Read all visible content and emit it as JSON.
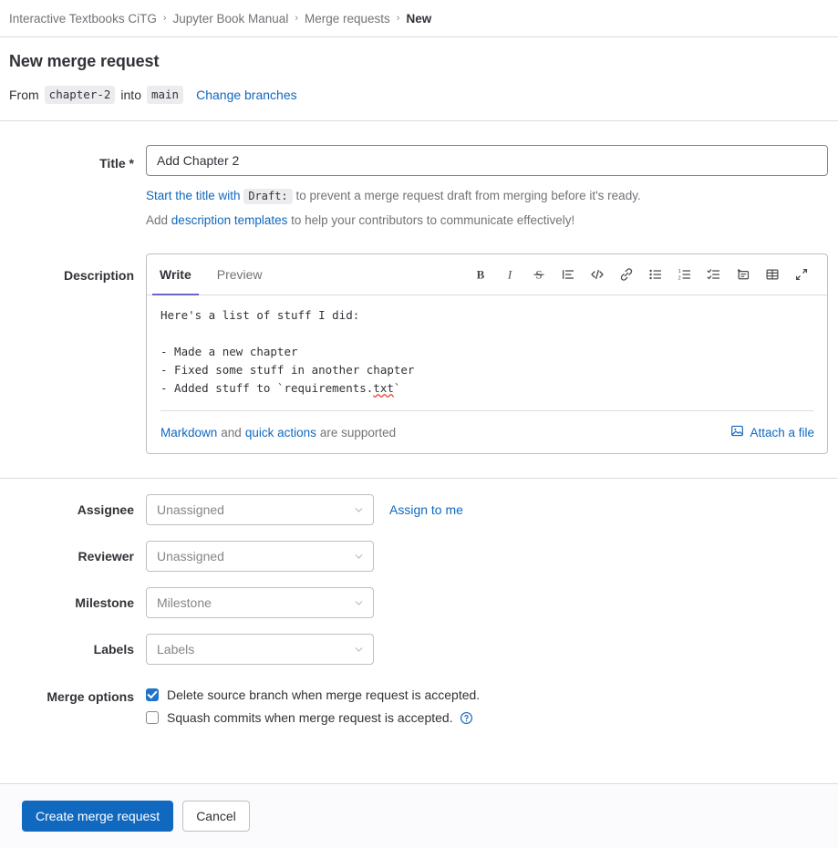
{
  "breadcrumb": {
    "separator": "›",
    "items": [
      {
        "label": "Interactive Textbooks CiTG",
        "current": false
      },
      {
        "label": "Jupyter Book Manual",
        "current": false
      },
      {
        "label": "Merge requests",
        "current": false
      },
      {
        "label": "New",
        "current": true
      }
    ]
  },
  "header": {
    "page_title": "New merge request",
    "from_word": "From",
    "source_branch": "chapter-2",
    "into_word": "into",
    "target_branch": "main",
    "change_branches_label": "Change branches"
  },
  "title_field": {
    "label": "Title *",
    "value": "Add Chapter 2",
    "placeholder": "",
    "help_1_link": "Start the title with",
    "help_1_code": "Draft:",
    "help_1_rest": "to prevent a merge request draft from merging before it's ready.",
    "help_2_prefix": "Add",
    "help_2_link": "description templates",
    "help_2_rest": "to help your contributors to communicate effectively!"
  },
  "description": {
    "label": "Description",
    "tabs": [
      {
        "label": "Write",
        "active": true
      },
      {
        "label": "Preview",
        "active": false
      }
    ],
    "toolbar": [
      {
        "name": "bold-icon",
        "title": "Bold"
      },
      {
        "name": "italic-icon",
        "title": "Italic"
      },
      {
        "name": "strikethrough-icon",
        "title": "Strikethrough"
      },
      {
        "name": "blockquote-icon",
        "title": "Insert a quote"
      },
      {
        "name": "code-icon",
        "title": "Insert code"
      },
      {
        "name": "link-icon",
        "title": "Insert a link"
      },
      {
        "name": "bullet-list-icon",
        "title": "Add a bullet list"
      },
      {
        "name": "numbered-list-icon",
        "title": "Add a numbered list"
      },
      {
        "name": "task-list-icon",
        "title": "Add a checklist"
      },
      {
        "name": "collapsible-section-icon",
        "title": "Add a collapsible section"
      },
      {
        "name": "table-icon",
        "title": "Add a table"
      },
      {
        "name": "fullscreen-icon",
        "title": "Go full screen"
      }
    ],
    "text_line_1": "Here's a list of stuff I did:",
    "text_line_2": "",
    "text_line_3": "- Made a new chapter",
    "text_line_4": "- Fixed some stuff in another chapter",
    "text_line_5_prefix": "- Added stuff to `requirements.",
    "text_line_5_misspelled": "txt",
    "text_line_5_suffix": "`",
    "footer_markdown_link": "Markdown",
    "footer_and": "and",
    "footer_quick_actions_link": "quick actions",
    "footer_supported": "are supported",
    "attach_label": "Attach a file",
    "attach_icon": "media-icon"
  },
  "fields": [
    {
      "label": "Assignee",
      "value": "Unassigned",
      "action": "Assign to me",
      "name": "assignee"
    },
    {
      "label": "Reviewer",
      "value": "Unassigned",
      "action": "",
      "name": "reviewer"
    },
    {
      "label": "Milestone",
      "value": "Milestone",
      "action": "",
      "name": "milestone"
    },
    {
      "label": "Labels",
      "value": "Labels",
      "action": "",
      "name": "labels"
    }
  ],
  "merge_options": {
    "label": "Merge options",
    "delete_branch_label": "Delete source branch when merge request is accepted.",
    "delete_branch_checked": true,
    "squash_label": "Squash commits when merge request is accepted.",
    "squash_checked": false,
    "help_icon": "question-circle-icon"
  },
  "actions": {
    "submit_label": "Create merge request",
    "cancel_label": "Cancel"
  },
  "colors": {
    "link": "#1068bf",
    "primary_button": "#1068bf",
    "checkbox_checked": "#1f75cb",
    "active_tab_underline": "#6666c4",
    "border": "#dcdcde",
    "muted_text": "#737278"
  }
}
